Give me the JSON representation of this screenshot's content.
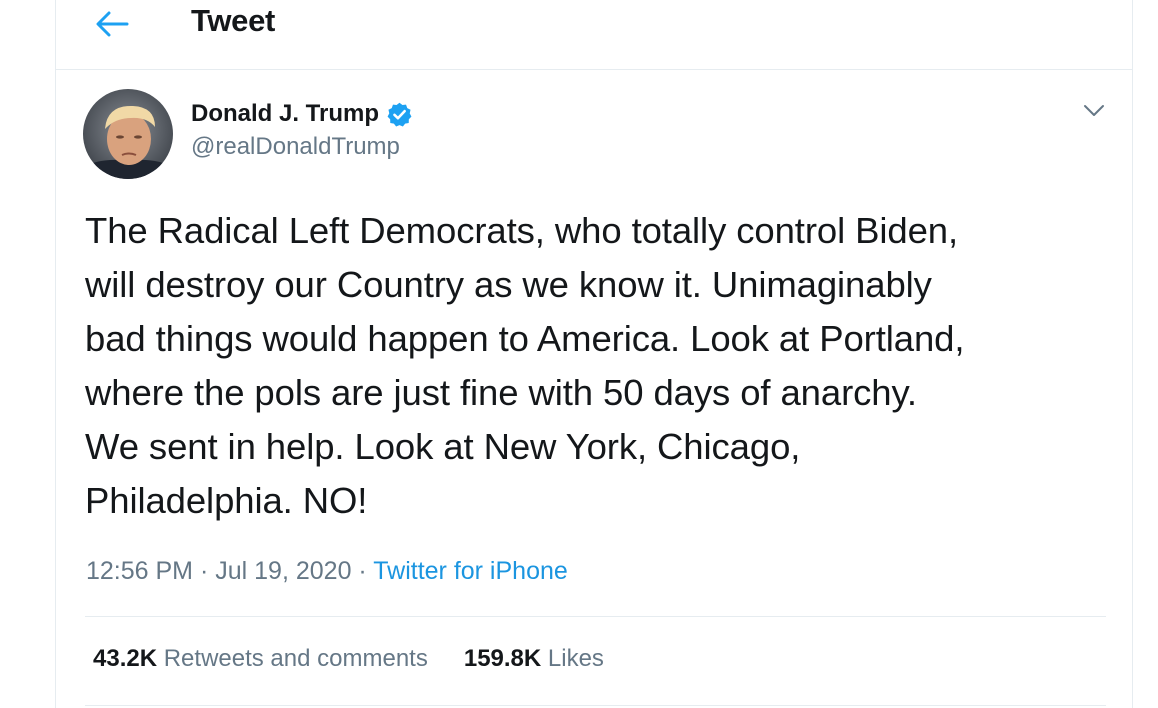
{
  "header": {
    "title": "Tweet",
    "back_icon": "arrow-left-icon"
  },
  "author": {
    "name": "Donald J. Trump",
    "handle": "@realDonaldTrump",
    "verified": true
  },
  "tweet": {
    "text_lines": [
      "The Radical Left Democrats, who totally control Biden,",
      "will destroy our Country as we know it. Unimaginably",
      "bad things would happen to America. Look at Portland,",
      "where the pols are just fine with 50 days of anarchy.",
      "We sent in help. Look at New York, Chicago,",
      "Philadelphia. NO!"
    ],
    "time": "12:56 PM",
    "date": "Jul 19, 2020",
    "separator": "·",
    "source": "Twitter for iPhone"
  },
  "stats": {
    "retweets_count": "43.2K",
    "retweets_label": "Retweets and comments",
    "likes_count": "159.8K",
    "likes_label": "Likes"
  },
  "colors": {
    "accent": "#1da1f2",
    "link": "#1b95e0",
    "secondary_text": "#657786",
    "border": "#e6ecf0"
  }
}
